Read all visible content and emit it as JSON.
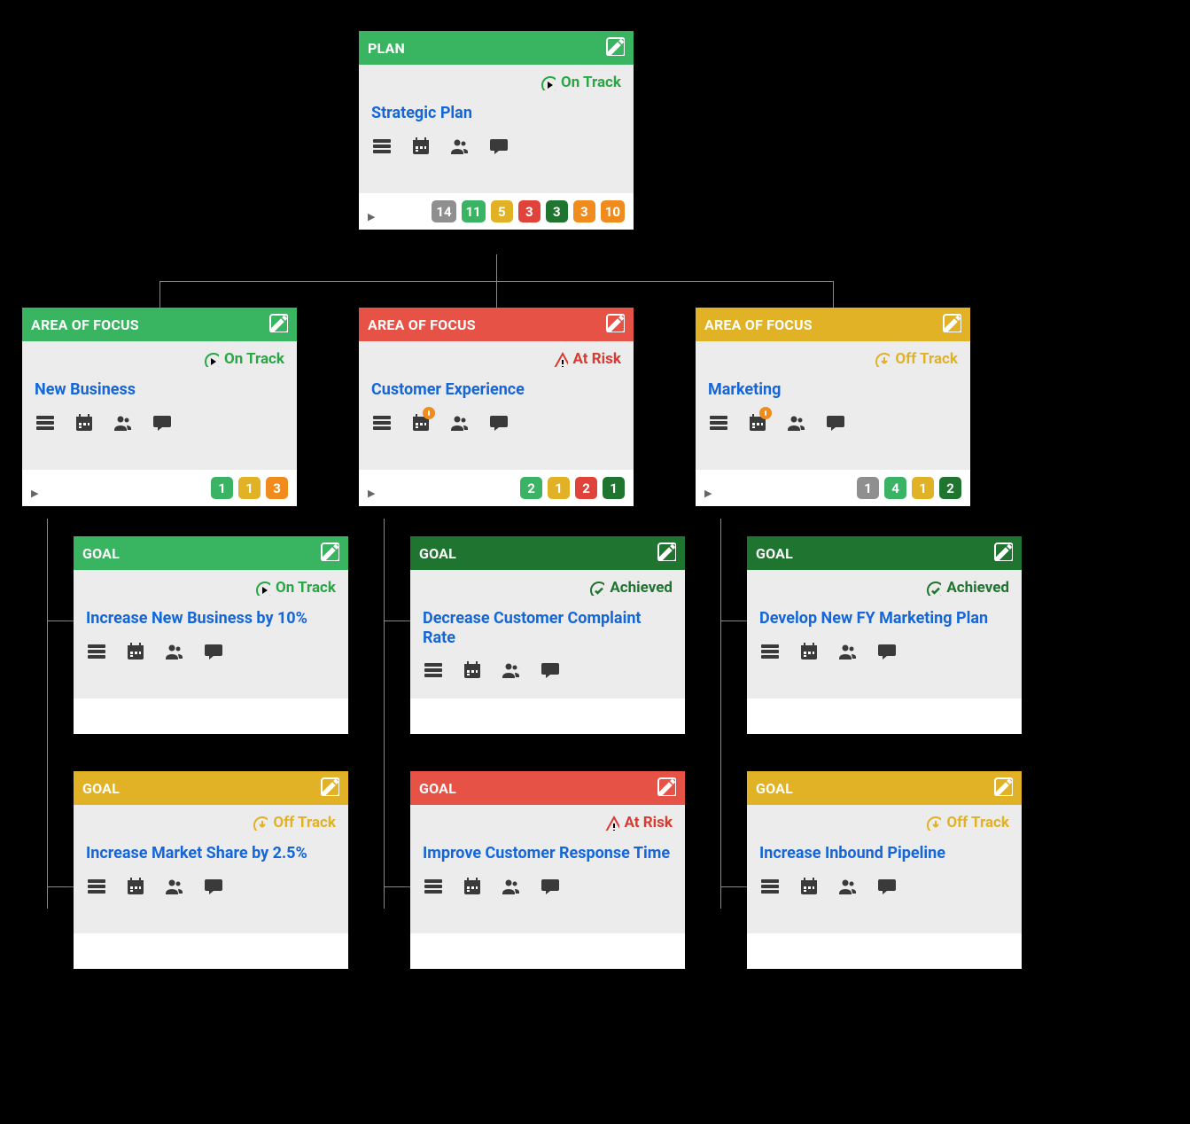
{
  "colors": {
    "green": "#39b461",
    "darkGreen": "#1f752f",
    "yellow": "#e1b225",
    "red": "#e75246",
    "orange": "#f08b1d",
    "grey": "#8f8f8f",
    "link": "#1567d9"
  },
  "plan": {
    "typeLabel": "PLAN",
    "status": "On Track",
    "title": "Strategic Plan",
    "counts": [
      {
        "value": "14",
        "color": "grey"
      },
      {
        "value": "11",
        "color": "green"
      },
      {
        "value": "5",
        "color": "yellow"
      },
      {
        "value": "3",
        "color": "red"
      },
      {
        "value": "3",
        "color": "dgreen"
      },
      {
        "value": "3",
        "color": "orange"
      },
      {
        "value": "10",
        "color": "orange"
      }
    ]
  },
  "areas": [
    {
      "typeLabel": "AREA OF FOCUS",
      "headerColor": "green",
      "status": "On Track",
      "title": "New Business",
      "calendarAlert": false,
      "counts": [
        {
          "value": "1",
          "color": "green"
        },
        {
          "value": "1",
          "color": "yellow"
        },
        {
          "value": "3",
          "color": "orange"
        }
      ],
      "goals": [
        {
          "typeLabel": "GOAL",
          "headerColor": "green",
          "status": "On Track",
          "title": "Increase New Business by 10%"
        },
        {
          "typeLabel": "GOAL",
          "headerColor": "yellow",
          "status": "Off Track",
          "title": "Increase Market Share by 2.5%"
        }
      ]
    },
    {
      "typeLabel": "AREA OF FOCUS",
      "headerColor": "red",
      "status": "At Risk",
      "title": "Customer Experience",
      "calendarAlert": true,
      "counts": [
        {
          "value": "2",
          "color": "green"
        },
        {
          "value": "1",
          "color": "yellow"
        },
        {
          "value": "2",
          "color": "red"
        },
        {
          "value": "1",
          "color": "dgreen"
        }
      ],
      "goals": [
        {
          "typeLabel": "GOAL",
          "headerColor": "dgreen",
          "status": "Achieved",
          "title": "Decrease Customer Complaint Rate"
        },
        {
          "typeLabel": "GOAL",
          "headerColor": "red",
          "status": "At Risk",
          "title": "Improve Customer Response Time"
        }
      ]
    },
    {
      "typeLabel": "AREA OF FOCUS",
      "headerColor": "yellow",
      "status": "Off Track",
      "title": "Marketing",
      "calendarAlert": true,
      "counts": [
        {
          "value": "1",
          "color": "grey"
        },
        {
          "value": "4",
          "color": "green"
        },
        {
          "value": "1",
          "color": "yellow"
        },
        {
          "value": "2",
          "color": "dgreen"
        }
      ],
      "goals": [
        {
          "typeLabel": "GOAL",
          "headerColor": "dgreen",
          "status": "Achieved",
          "title": "Develop New FY Marketing Plan"
        },
        {
          "typeLabel": "GOAL",
          "headerColor": "yellow",
          "status": "Off Track",
          "title": "Increase Inbound Pipeline"
        }
      ]
    }
  ]
}
